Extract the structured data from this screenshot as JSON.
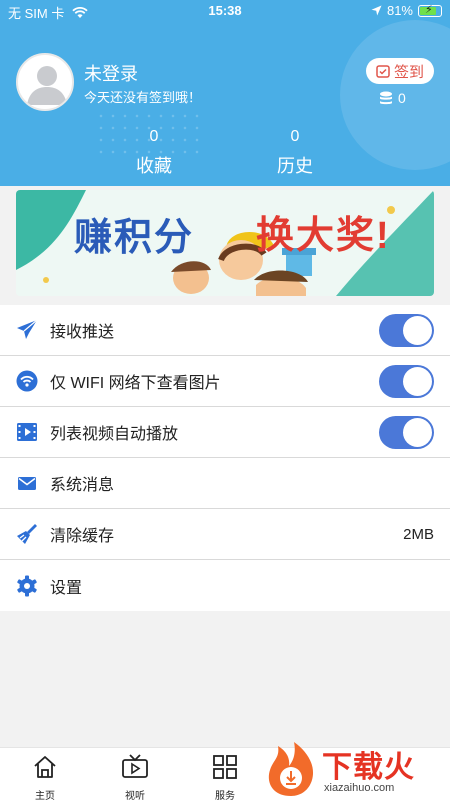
{
  "status_bar": {
    "carrier": "无 SIM 卡",
    "time": "15:38",
    "battery": "81%"
  },
  "profile": {
    "name": "未登录",
    "subtitle": "今天还没有签到哦！"
  },
  "signin": {
    "label": "签到",
    "coins": "0"
  },
  "stats": [
    {
      "count": "0",
      "label": "收藏"
    },
    {
      "count": "0",
      "label": "历史"
    }
  ],
  "banner": {
    "text_left": "赚积分",
    "text_right": "换大奖!"
  },
  "settings": [
    {
      "label": "接收推送",
      "icon": "paper-plane-icon",
      "toggle_on": true
    },
    {
      "label": "仅 WIFI 网络下查看图片",
      "icon": "wifi-icon",
      "toggle_on": true
    },
    {
      "label": "列表视频自动播放",
      "icon": "video-film-icon",
      "toggle_on": true
    },
    {
      "label": "系统消息",
      "icon": "envelope-icon"
    },
    {
      "label": "清除缓存",
      "icon": "broom-icon",
      "value": "2MB"
    },
    {
      "label": "设置",
      "icon": "gear-icon"
    }
  ],
  "tabs": [
    {
      "label": "主页",
      "icon": "home-icon"
    },
    {
      "label": "视听",
      "icon": "tv-icon"
    },
    {
      "label": "服务",
      "icon": "grid-icon"
    }
  ],
  "watermark": {
    "text": "下载火",
    "url": "xiazaihuo.com"
  },
  "colors": {
    "header": "#4aaee6",
    "accent": "#4b78d8",
    "signin": "#e0554a",
    "icon_blue": "#2d6fd6"
  }
}
